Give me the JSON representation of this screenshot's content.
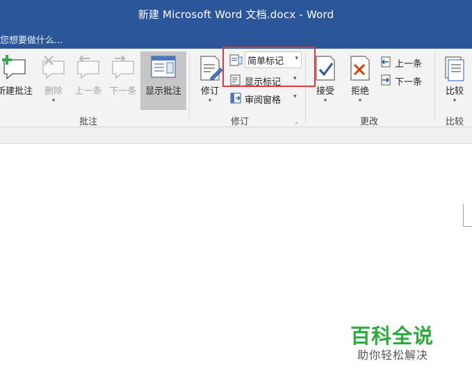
{
  "window": {
    "title": "新建 Microsoft Word 文档.docx - Word"
  },
  "tell_me": {
    "placeholder": "您想要做什么..."
  },
  "ribbon": {
    "comments_group": {
      "label": "批注",
      "new_comment": "新建批注",
      "delete": "删除",
      "previous": "上一条",
      "next": "下一条",
      "show_comments": "显示批注"
    },
    "tracking_group": {
      "label": "修订",
      "track_changes": "修订",
      "markup_view": "简单标记",
      "show_markup": "显示标记",
      "reviewing_pane": "审阅窗格"
    },
    "changes_group": {
      "label": "更改",
      "accept": "接受",
      "reject": "拒绝",
      "previous": "上一条",
      "next": "下一条"
    },
    "compare_group": {
      "label": "比较",
      "compare": "比较"
    }
  },
  "watermark": {
    "main": "百科全说",
    "sub": "助你轻松解决"
  },
  "colors": {
    "title_bar": "#2b579a",
    "accent_check": "#2b579a",
    "reject_x": "#d83b01",
    "highlight_box": "#e0343f",
    "watermark": "#2bab3b"
  }
}
